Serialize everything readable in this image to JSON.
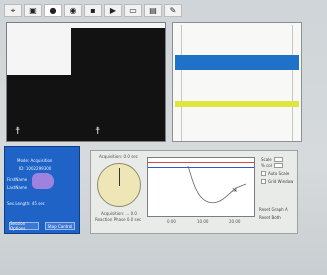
{
  "toolbar": {
    "buttons": [
      {
        "name": "pointer-tool",
        "glyph": "⌖"
      },
      {
        "name": "camera-tool",
        "glyph": "▣"
      },
      {
        "name": "record-tool",
        "glyph": "●"
      },
      {
        "name": "target-tool",
        "glyph": "◉"
      },
      {
        "name": "stop-tool",
        "glyph": "▪"
      },
      {
        "name": "play-tool",
        "glyph": "▶"
      },
      {
        "name": "save-tool",
        "glyph": "▭"
      },
      {
        "name": "grid-tool",
        "glyph": "▤"
      },
      {
        "name": "pencil-tool",
        "glyph": "✎"
      }
    ]
  },
  "info_panel": {
    "mode": "Mode: Acquisition",
    "id": "ID: 1002299300",
    "first_name_label": "FirstName",
    "last_name_label": "LastName",
    "session_length": "Ses.Length: 45 sec",
    "button_left": "Session Options",
    "button_right": "Stop Control"
  },
  "main_panel": {
    "top_label": "Acquisition: 0.0 sec",
    "bottom_label": "Acquisition: ... 0.0",
    "bottom_label2": "Reaction Phase 0.0 sec",
    "x_ticks": [
      "0.00",
      "10.00",
      "20.00"
    ],
    "side_items": [
      "Scale",
      "% col",
      "Auto Scale",
      "Grid Window",
      "Reset Graph A",
      "Reset Both"
    ],
    "accent": "#1f63c6",
    "clock_face": "#efe6b8"
  }
}
